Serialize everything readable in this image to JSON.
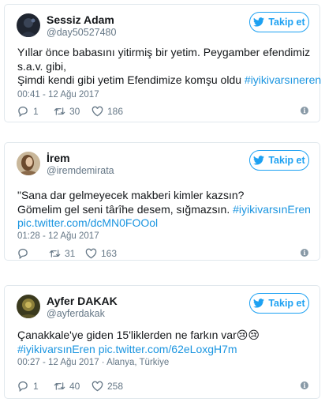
{
  "follow_label": "Takip et",
  "colors": {
    "link": "#1b95e0",
    "follow": "#1da1f2",
    "muted": "#657786",
    "border": "#e1e8ed"
  },
  "tweets": [
    {
      "name": "Sessiz Adam",
      "handle": "@day50527480",
      "lines": [
        "Yıllar önce babasını yitirmiş bir yetim. Peygamber efendimiz",
        "s.a.v. gibi,",
        "Şimdi kendi gibi yetim Efendimize komşu oldu "
      ],
      "hashtag": "#iyikivarsıneren",
      "meta": "00:41 - 12 Ağu 2017",
      "replies": "1",
      "retweets": "30",
      "likes": "186"
    },
    {
      "name": "İrem",
      "handle": "@iremdemirata",
      "lines": [
        "\"Sana dar gelmeyecek makberi kimler kazsın?",
        "Gömelim gel seni târîhe desem, sığmazsın. "
      ],
      "hashtag": "#iyikivarsınEren",
      "link": "pic.twitter.com/dcMN0FOOol",
      "meta": "01:28 - 12 Ağu 2017",
      "replies": "",
      "retweets": "31",
      "likes": "163"
    },
    {
      "name": "Ayfer DAKAK",
      "handle": "@ayferdakak",
      "lines": [
        "Çanakkale'ye giden 15'liklerden ne farkın var"
      ],
      "emoji": "😢😢",
      "hashtag": "#iyikivarsınEren",
      "link": "pic.twitter.com/62eLoxgH7m",
      "meta": "00:27 - 12 Ağu 2017 · Alanya, Türkiye",
      "replies": "1",
      "retweets": "40",
      "likes": "258"
    }
  ]
}
